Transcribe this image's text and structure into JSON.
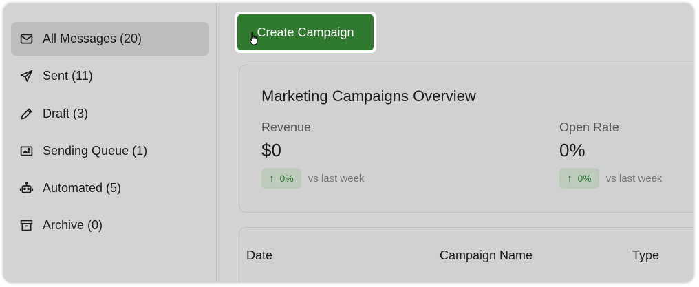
{
  "sidebar": {
    "items": [
      {
        "label": "All Messages (20)",
        "icon": "envelope-icon",
        "active": true
      },
      {
        "label": "Sent (11)",
        "icon": "paper-plane-icon"
      },
      {
        "label": "Draft (3)",
        "icon": "pencil-icon"
      },
      {
        "label": "Sending Queue (1)",
        "icon": "image-icon"
      },
      {
        "label": "Automated (5)",
        "icon": "robot-icon"
      },
      {
        "label": "Archive (0)",
        "icon": "archive-box-icon"
      }
    ]
  },
  "toolbar": {
    "create_label": "Create Campaign"
  },
  "overview": {
    "title": "Marketing Campaigns Overview",
    "metrics": [
      {
        "label": "Revenue",
        "value": "$0",
        "delta": "0%",
        "vs": "vs last week"
      },
      {
        "label": "Open Rate",
        "value": "0%",
        "delta": "0%",
        "vs": "vs last week"
      }
    ]
  },
  "table": {
    "columns": [
      "Date",
      "Campaign Name",
      "Type"
    ]
  },
  "colors": {
    "accent": "#2f7a2f",
    "delta_bg": "#bccbbc",
    "panel": "#d3d3d3"
  }
}
